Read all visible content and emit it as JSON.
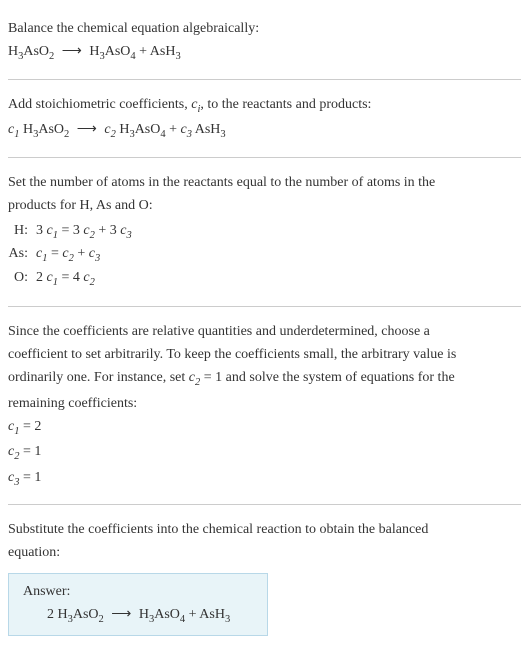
{
  "header": {
    "title": "Balance the chemical equation algebraically:",
    "equation_lhs": "H",
    "equation_lhs2": "AsO",
    "equation_arrow": "⟶",
    "equation_rhs1": "H",
    "equation_rhs2": "AsO",
    "equation_plus": " + AsH"
  },
  "stoich": {
    "intro1": "Add stoichiometric coefficients, ",
    "ci": "c",
    "intro2": ", to the reactants and products:",
    "c1": "c",
    "sp1": " H",
    "sp1b": "AsO",
    "arrow": "⟶",
    "c2": "c",
    "sp2": " H",
    "sp2b": "AsO",
    "plus": " + ",
    "c3": "c",
    "sp3": " AsH"
  },
  "atoms": {
    "intro1": "Set the number of atoms in the reactants equal to the number of atoms in the",
    "intro2": "products for H, As and O:",
    "rows": [
      {
        "label": "H:",
        "eq_a": "3 ",
        "c1": "c",
        "eq_b": " = 3 ",
        "c2": "c",
        "eq_c": " + 3 ",
        "c3": "c"
      },
      {
        "label": "As:",
        "eq_a": "",
        "c1": "c",
        "eq_b": " = ",
        "c2": "c",
        "eq_c": " + ",
        "c3": "c"
      },
      {
        "label": "O:",
        "eq_a": "2 ",
        "c1": "c",
        "eq_b": " = 4 ",
        "c2": "c",
        "eq_c": "",
        "c3": ""
      }
    ]
  },
  "solve": {
    "p1": "Since the coefficients are relative quantities and underdetermined, choose a",
    "p2": "coefficient to set arbitrarily. To keep the coefficients small, the arbitrary value is",
    "p3a": "ordinarily one. For instance, set ",
    "c2": "c",
    "p3b": " = 1 and solve the system of equations for the",
    "p4": "remaining coefficients:",
    "r1a": "c",
    "r1b": " = 2",
    "r2a": "c",
    "r2b": " = 1",
    "r3a": "c",
    "r3b": " = 1"
  },
  "subst": {
    "p1": "Substitute the coefficients into the chemical reaction to obtain the balanced",
    "p2": "equation:"
  },
  "answer": {
    "label": "Answer:",
    "coef1": "2 H",
    "sp1": "AsO",
    "arrow": "⟶",
    "sp2": "H",
    "sp2b": "AsO",
    "plus": " + AsH"
  }
}
